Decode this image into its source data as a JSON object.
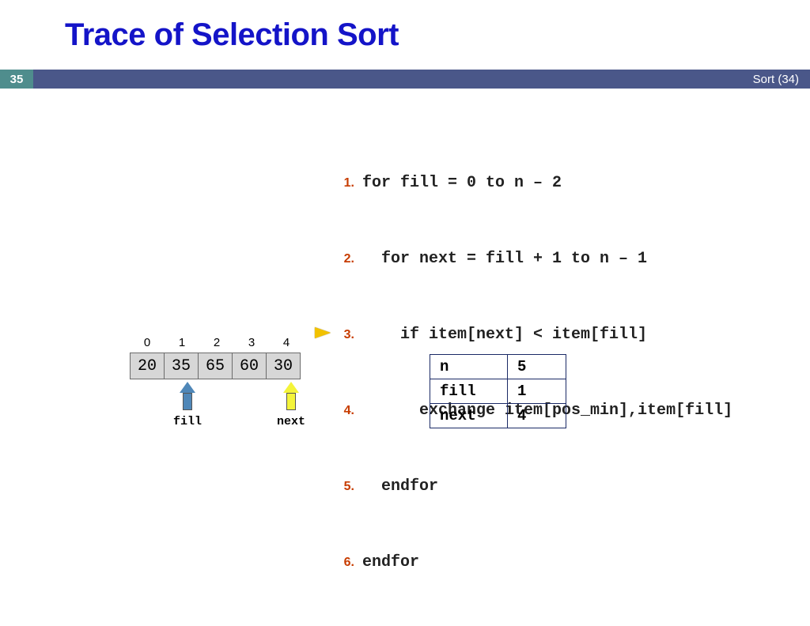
{
  "title": "Trace of Selection Sort",
  "bar": {
    "page_num": "35",
    "right": "Sort (34)"
  },
  "code": {
    "pointer_line": 3,
    "lines": [
      {
        "n": "1.",
        "text": "for fill = 0 to n – 2"
      },
      {
        "n": "2.",
        "text": "  for next = fill + 1 to n – 1"
      },
      {
        "n": "3.",
        "text": "    if item[next] < item[fill]"
      },
      {
        "n": "4.",
        "text": "      exchange item[pos_min],item[fill]"
      },
      {
        "n": "5.",
        "text": "  endfor"
      },
      {
        "n": "6.",
        "text": "endfor"
      }
    ]
  },
  "array": {
    "indices": [
      "0",
      "1",
      "2",
      "3",
      "4"
    ],
    "values": [
      "20",
      "35",
      "65",
      "60",
      "30"
    ],
    "fill_arrow": {
      "index": 1,
      "label": "fill"
    },
    "next_arrow": {
      "index": 4,
      "label": "next"
    }
  },
  "vars": [
    {
      "name": "n",
      "value": "5"
    },
    {
      "name": "fill",
      "value": "1"
    },
    {
      "name": "next",
      "value": "4"
    }
  ]
}
